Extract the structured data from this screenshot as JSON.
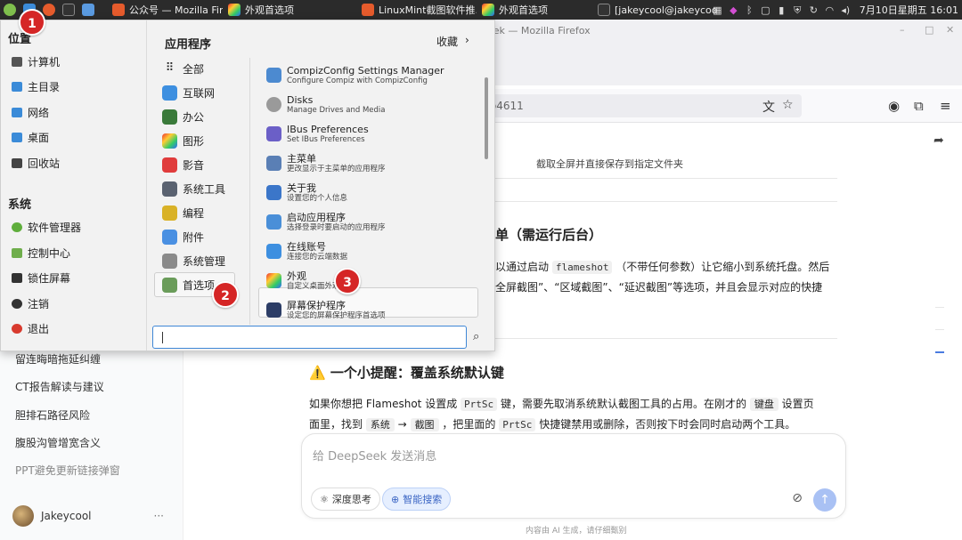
{
  "taskbar": {
    "tasks": [
      {
        "label": "公众号 — Mozilla Fir..."
      },
      {
        "label": "外观首选项"
      },
      {
        "label": "LinuxMint截图软件推..."
      },
      {
        "label": "外观首选项"
      },
      {
        "label": "[jakeycool@jakeycoo..."
      }
    ],
    "clock": "7月10日星期五 16:01"
  },
  "firefox": {
    "title": "Seek — Mozilla Firefox",
    "url_fragment": "0b4611"
  },
  "sidebar": {
    "items": [
      "留连晦暗拖延纠缠",
      "CT报告解读与建议",
      "胆排石路径风险",
      "腹股沟管增宽含义",
      "PPT避免更新链接弹窗"
    ],
    "user": "Jakeycool",
    "more": "···"
  },
  "article": {
    "fragment_top": "截取全屏并直接保存到指定文件夹",
    "heading1": "单（需运行后台）",
    "p1_a": "以通过启动",
    "p1_code": "flameshot",
    "p1_b": "（不带任何参数）让它缩小到系统托盘。然后",
    "p2": "全屏截图”、“区域截图”、“延迟截图”等选项，并且会显示对应的快捷",
    "heading2": "⚠️ 一个小提醒：覆盖系统默认键",
    "p3_a": "如果你想把 Flameshot 设置成",
    "p3_code": "PrtSc",
    "p3_b": "键，需要先取消系统默认截图工具的占用。在刚才的",
    "p3_k1": "键盘",
    "p3_c": "设置页",
    "p4_a": "面里，找到",
    "p4_k1": "系统",
    "p4_arrow": "→",
    "p4_k2": "截图",
    "p4_b": "，把里面的",
    "p4_k3": "PrtSc",
    "p4_c": "快捷键禁用或删除，否则按下时会同时启动两个工具。"
  },
  "chat": {
    "placeholder": "给 DeepSeek 发送消息",
    "deep_think": "深度思考",
    "smart_search": "智能搜索",
    "footer": "内容由 AI 生成，请仔细甄别"
  },
  "menu": {
    "places_header": "位置",
    "places": [
      "计算机",
      "主目录",
      "网络",
      "桌面",
      "回收站"
    ],
    "system_header": "系统",
    "system": [
      "软件管理器",
      "控制中心",
      "锁住屏幕",
      "注销",
      "退出"
    ],
    "apps_header": "应用程序",
    "favorites": "收藏",
    "categories": [
      "全部",
      "互联网",
      "办公",
      "图形",
      "影音",
      "系统工具",
      "编程",
      "附件",
      "系统管理",
      "首选项"
    ],
    "apps": [
      {
        "name": "CompizConfig Settings Manager",
        "desc": "Configure Compiz with CompizConfig"
      },
      {
        "name": "Disks",
        "desc": "Manage Drives and Media"
      },
      {
        "name": "IBus Preferences",
        "desc": "Set IBus Preferences"
      },
      {
        "name": "主菜单",
        "desc": "更改显示于主菜单的应用程序"
      },
      {
        "name": "关于我",
        "desc": "设置您的个人信息"
      },
      {
        "name": "启动应用程序",
        "desc": "选择登录时要启动的应用程序"
      },
      {
        "name": "在线账号",
        "desc": "连接您的云端数据"
      },
      {
        "name": "外观",
        "desc": "自定义桌面外观"
      },
      {
        "name": "屏幕保护程序",
        "desc": "设定您的屏幕保护程序首选项"
      }
    ],
    "search_value": ""
  },
  "callouts": [
    "1",
    "2",
    "3"
  ]
}
